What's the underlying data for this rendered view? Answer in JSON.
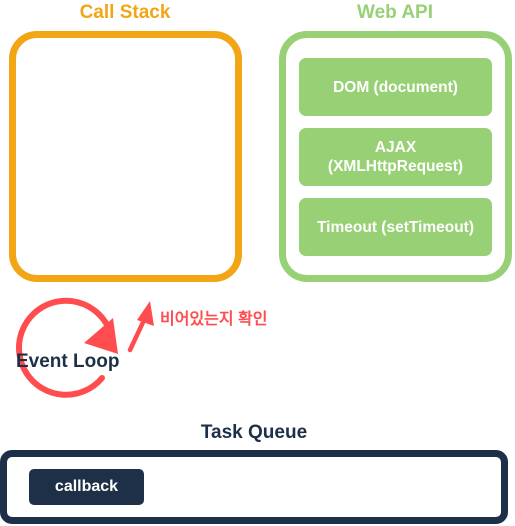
{
  "colors": {
    "call_stack": "#f2a515",
    "web_api": "#98d075",
    "event_loop": "#ff4d4f",
    "navy": "#1e3048"
  },
  "call_stack": {
    "title": "Call Stack"
  },
  "web_api": {
    "title": "Web API",
    "items": [
      "DOM (document)",
      "AJAX\n(XMLHttpRequest)",
      "Timeout (setTimeout)"
    ]
  },
  "event_loop": {
    "label": "Event Loop",
    "check_text": "비어있는지 확인"
  },
  "task_queue": {
    "title": "Task Queue",
    "items": [
      "callback"
    ]
  }
}
